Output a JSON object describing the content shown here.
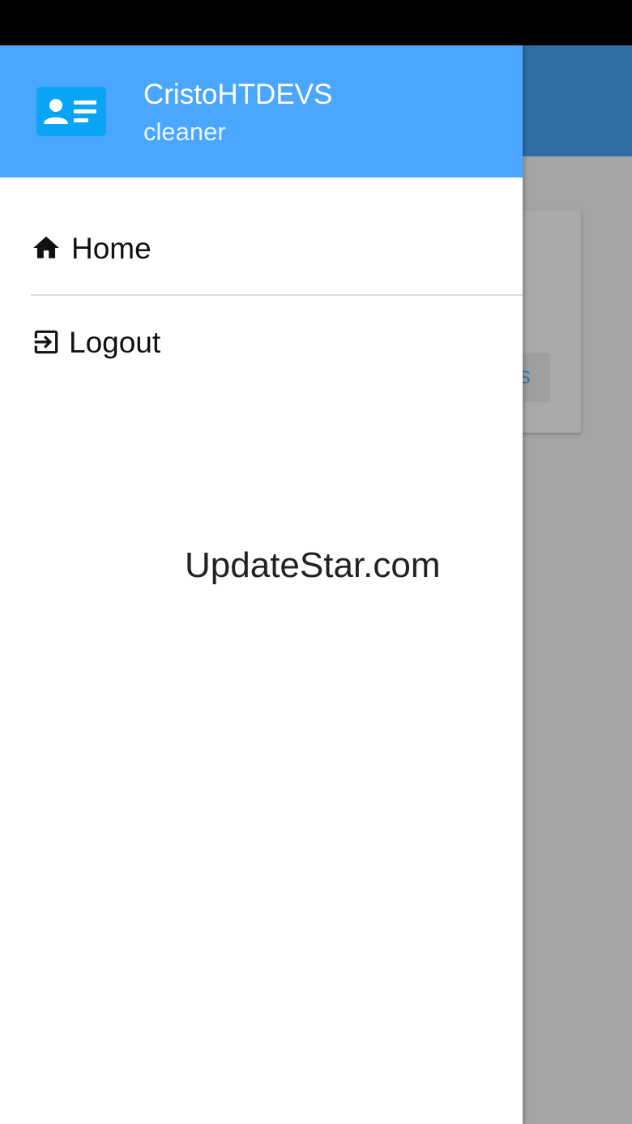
{
  "drawer": {
    "header": {
      "icon": "contact-card-icon",
      "user_name": "CristoHTDEVS",
      "user_role": "cleaner"
    },
    "items": [
      {
        "icon": "home-icon",
        "label": "Home"
      },
      {
        "icon": "logout-icon",
        "label": "Logout"
      }
    ]
  },
  "background_app": {
    "card_button_text_fragment": "s"
  },
  "watermark": "UpdateStar.com",
  "colors": {
    "drawer_header": "#4aa6fe",
    "app_bar": "#2f6ea6",
    "scrim": "#a5a5a5"
  }
}
